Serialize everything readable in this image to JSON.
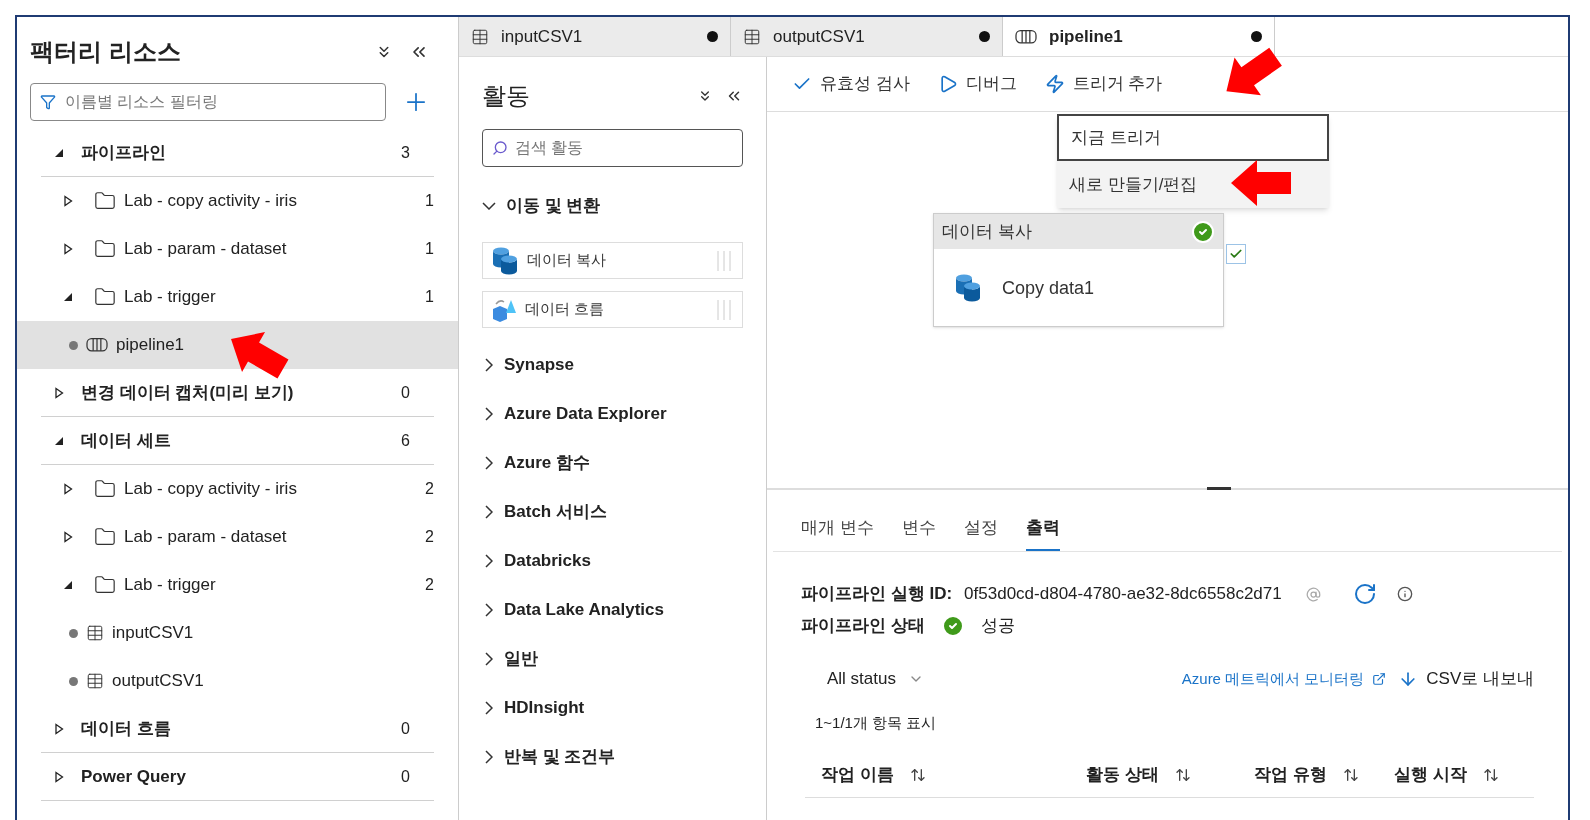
{
  "sidebar": {
    "title": "팩터리 리소스",
    "filter_placeholder": "이름별 리소스 필터링",
    "sections": [
      {
        "label": "파이프라인",
        "count": "3",
        "expanded": true,
        "children": [
          {
            "label": "Lab - copy activity - iris",
            "count": "1",
            "expanded": false
          },
          {
            "label": "Lab - param - dataset",
            "count": "1",
            "expanded": false
          },
          {
            "label": "Lab - trigger",
            "count": "1",
            "expanded": true,
            "children": [
              {
                "label": "pipeline1",
                "kind": "pipeline",
                "selected": true
              }
            ]
          }
        ]
      },
      {
        "label": "변경 데이터 캡처(미리 보기)",
        "count": "0",
        "expanded": false
      },
      {
        "label": "데이터 세트",
        "count": "6",
        "expanded": true,
        "children": [
          {
            "label": "Lab - copy activity - iris",
            "count": "2",
            "expanded": false
          },
          {
            "label": "Lab - param - dataset",
            "count": "2",
            "expanded": false
          },
          {
            "label": "Lab - trigger",
            "count": "2",
            "expanded": true,
            "children": [
              {
                "label": "inputCSV1",
                "kind": "dataset",
                "selected": false
              },
              {
                "label": "outputCSV1",
                "kind": "dataset",
                "selected": false
              }
            ]
          }
        ]
      },
      {
        "label": "데이터 흐름",
        "count": "0",
        "expanded": false
      },
      {
        "label": "Power Query",
        "count": "0",
        "expanded": false
      }
    ]
  },
  "tabs": [
    {
      "label": "inputCSV1",
      "kind": "dataset",
      "unsaved": true,
      "selected": false
    },
    {
      "label": "outputCSV1",
      "kind": "dataset",
      "unsaved": true,
      "selected": false
    },
    {
      "label": "pipeline1",
      "kind": "pipeline",
      "unsaved": true,
      "selected": true
    }
  ],
  "activities": {
    "title": "활동",
    "search_placeholder": "검색 활동",
    "groups": [
      {
        "label": "이동 및 변환",
        "expanded": true,
        "items": [
          {
            "label": "데이터 복사",
            "kind": "copy"
          },
          {
            "label": "데이터 흐름",
            "kind": "dataflow"
          }
        ]
      },
      {
        "label": "Synapse",
        "expanded": false
      },
      {
        "label": "Azure Data Explorer",
        "expanded": false
      },
      {
        "label": "Azure 함수",
        "expanded": false
      },
      {
        "label": "Batch 서비스",
        "expanded": false
      },
      {
        "label": "Databricks",
        "expanded": false
      },
      {
        "label": "Data Lake Analytics",
        "expanded": false
      },
      {
        "label": "일반",
        "expanded": false
      },
      {
        "label": "HDInsight",
        "expanded": false
      },
      {
        "label": "반복 및 조건부",
        "expanded": false
      }
    ]
  },
  "toolbar": [
    {
      "label": "유효성 검사",
      "kind": "validate"
    },
    {
      "label": "디버그",
      "kind": "debug"
    },
    {
      "label": "트리거 추가",
      "kind": "trigger"
    }
  ],
  "trigger_menu": [
    {
      "label": "지금 트리거",
      "focused": true,
      "hovered": false
    },
    {
      "label": "새로 만들기/편집",
      "focused": false,
      "hovered": true
    }
  ],
  "canvas_activity": {
    "header": "데이터 복사",
    "name": "Copy data1",
    "succeeded": true
  },
  "bottom_tabs": [
    {
      "label": "매개 변수",
      "selected": false
    },
    {
      "label": "변수",
      "selected": false
    },
    {
      "label": "설정",
      "selected": false
    },
    {
      "label": "출력",
      "selected": true
    }
  ],
  "output": {
    "run_id_label": "파이프라인 실행 ID:",
    "run_id": "0f53d0cd-d804-4780-ae32-8dc6558c2d71",
    "status_label": "파이프라인 상태",
    "succeeded": true,
    "status_text": "성공",
    "filter": "All status",
    "monitor_link": "Azure 메트릭에서 모니터링",
    "export": "CSV로 내보내",
    "count_text": "1~1/1개 항목 표시",
    "columns": [
      "작업 이름",
      "활동 상태",
      "작업 유형",
      "실행 시작"
    ]
  }
}
